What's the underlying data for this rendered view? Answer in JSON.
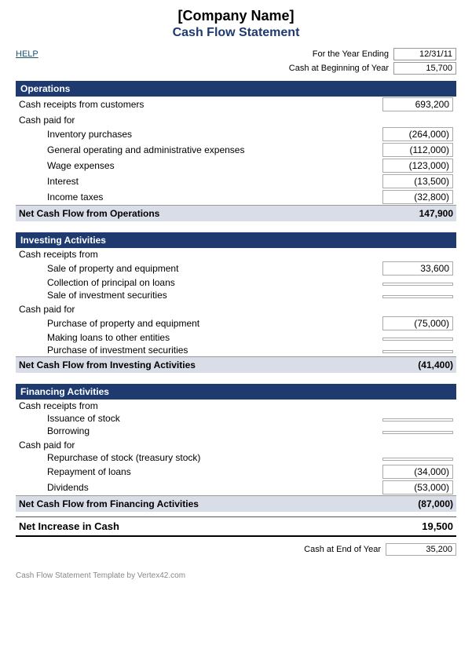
{
  "company": {
    "name": "[Company Name]",
    "title": "Cash Flow Statement"
  },
  "header": {
    "help_label": "HELP",
    "for_year_label": "For the Year Ending",
    "year_value": "12/31/11",
    "cash_beginning_label": "Cash at Beginning of Year",
    "cash_beginning_value": "15,700"
  },
  "operations": {
    "section_label": "Operations",
    "items": [
      {
        "label": "Cash receipts from customers",
        "value": "693,200",
        "indent": 0
      },
      {
        "label": "Cash paid for",
        "value": "",
        "indent": 0
      },
      {
        "label": "Inventory purchases",
        "value": "(264,000)",
        "indent": 2
      },
      {
        "label": "General operating and administrative expenses",
        "value": "(112,000)",
        "indent": 2
      },
      {
        "label": "Wage expenses",
        "value": "(123,000)",
        "indent": 2
      },
      {
        "label": "Interest",
        "value": "(13,500)",
        "indent": 2
      },
      {
        "label": "Income taxes",
        "value": "(32,800)",
        "indent": 2
      }
    ],
    "net_label": "Net Cash Flow from Operations",
    "net_value": "147,900"
  },
  "investing": {
    "section_label": "Investing Activities",
    "receipts_label": "Cash receipts from",
    "receipt_items": [
      {
        "label": "Sale of property and equipment",
        "value": "33,600",
        "indent": 2
      },
      {
        "label": "Collection of principal on loans",
        "value": "",
        "indent": 2
      },
      {
        "label": "Sale of investment securities",
        "value": "",
        "indent": 2
      }
    ],
    "paid_label": "Cash paid for",
    "paid_items": [
      {
        "label": "Purchase of property and equipment",
        "value": "(75,000)",
        "indent": 2
      },
      {
        "label": "Making loans to other entities",
        "value": "",
        "indent": 2
      },
      {
        "label": "Purchase of investment securities",
        "value": "",
        "indent": 2
      }
    ],
    "net_label": "Net Cash Flow from Investing Activities",
    "net_value": "(41,400)"
  },
  "financing": {
    "section_label": "Financing Activities",
    "receipts_label": "Cash receipts from",
    "receipt_items": [
      {
        "label": "Issuance of stock",
        "value": "",
        "indent": 2
      },
      {
        "label": "Borrowing",
        "value": "",
        "indent": 2
      }
    ],
    "paid_label": "Cash paid for",
    "paid_items": [
      {
        "label": "Repurchase of stock (treasury stock)",
        "value": "",
        "indent": 2
      },
      {
        "label": "Repayment of loans",
        "value": "(34,000)",
        "indent": 2
      },
      {
        "label": "Dividends",
        "value": "(53,000)",
        "indent": 2
      }
    ],
    "net_label": "Net Cash Flow from Financing Activities",
    "net_value": "(87,000)"
  },
  "net_increase": {
    "label": "Net Increase in Cash",
    "value": "19,500"
  },
  "footer": {
    "cash_end_label": "Cash at End of Year",
    "cash_end_value": "35,200",
    "credit": "Cash Flow Statement Template by Vertex42.com"
  }
}
